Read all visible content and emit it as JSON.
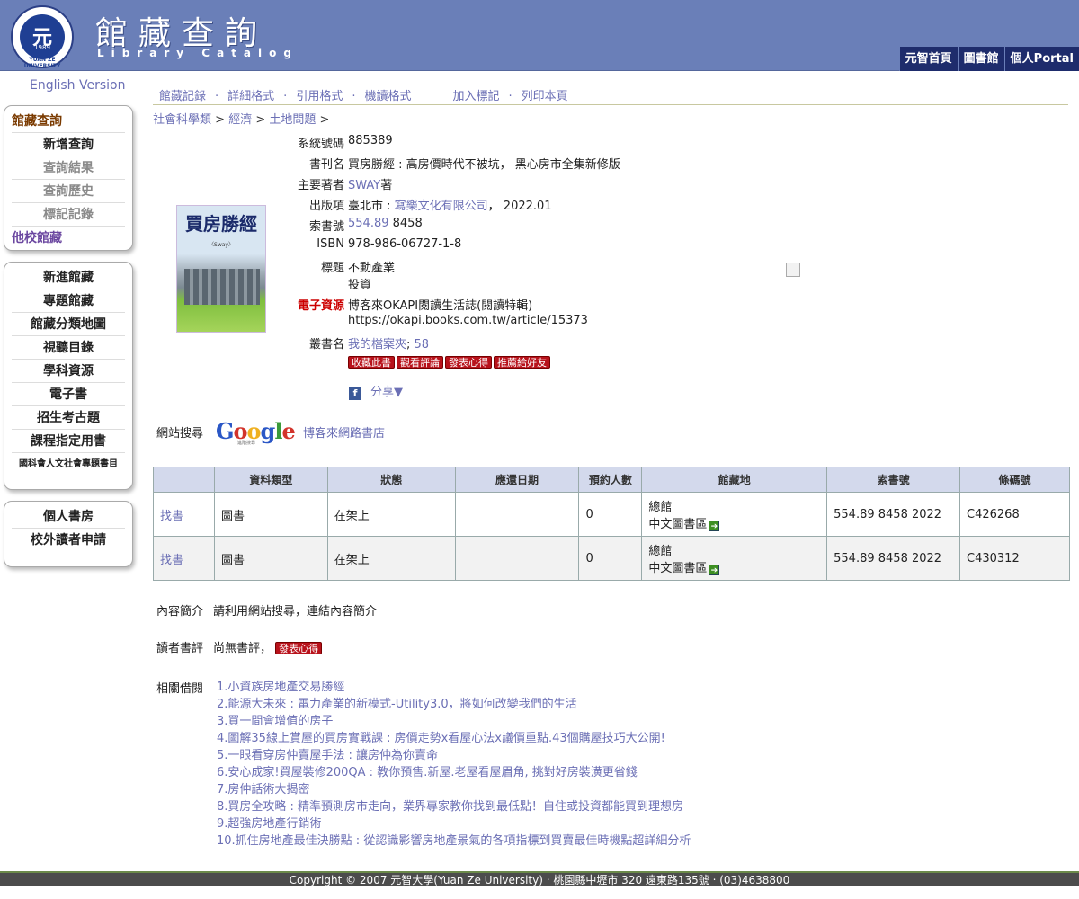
{
  "header": {
    "logo_year": "1989",
    "logo_ring_text": "YUAN ZE UNIVERSITY",
    "title": "館藏查詢",
    "subtitle": "Library Catalog",
    "nav": [
      "元智首頁",
      "圖書館",
      "個人Portal"
    ]
  },
  "sidebar": {
    "english_version": "English Version",
    "box1": {
      "head": "館藏查詢",
      "items": [
        "新增查詢",
        "查詢結果",
        "查詢歷史",
        "標記記錄"
      ],
      "footer": "他校館藏"
    },
    "box2": {
      "items": [
        "新進館藏",
        "專題館藏",
        "館藏分類地圖",
        "視聽目錄",
        "學科資源",
        "電子書",
        "招生考古題",
        "課程指定用書",
        "國科會人文社會專題書目"
      ]
    },
    "box3": {
      "items": [
        "個人書房",
        "校外讀者申請"
      ]
    }
  },
  "actions": [
    "館藏記錄",
    "詳細格式",
    "引用格式",
    "機讀格式",
    "加入標記",
    "列印本頁"
  ],
  "breadcrumb": [
    "社會科學類",
    "經濟",
    "土地問題"
  ],
  "cover": {
    "title": "買房勝經",
    "author_tag": "〈Sway〉"
  },
  "record": {
    "system_no_label": "系統號碼",
    "system_no": "885389",
    "title_label": "書刊名",
    "title": "買房勝經 : 高房價時代不被坑， 黑心房市全集新修版",
    "author_label": "主要著者",
    "author": "SWAY",
    "author_suffix": "著",
    "publisher_label": "出版項",
    "pub_place": "臺北市 : ",
    "publisher": "寫樂文化有限公司",
    "pub_date": "，  2022.01",
    "callno_label": "索書號",
    "callno_link": "554.89",
    "callno_rest": "8458",
    "isbn_label": "ISBN",
    "isbn": "978-986-06727-1-8",
    "subject_label": "標題",
    "subjects": [
      "不動產業",
      "投資"
    ],
    "eresource_label": "電子資源",
    "eresource_text": "博客來OKAPI閱讀生活誌(閱讀特輯)",
    "eresource_url": "https://okapi.books.com.tw/article/15373",
    "series_label": "叢書名",
    "series": "我的檔案夾",
    "series_sep": "; ",
    "series_no": "58",
    "buttons": [
      "收藏此書",
      "觀看評論",
      "發表心得",
      "推薦給好友"
    ],
    "share": "分享▼"
  },
  "web_search": {
    "label": "網站搜尋",
    "google_letters": [
      "G",
      "o",
      "o",
      "g",
      "l",
      "e"
    ],
    "google_sub": "進階搜尋",
    "bookstore": "博客來網路書店"
  },
  "holdings": {
    "headers": [
      "",
      "資料類型",
      "狀態",
      "應還日期",
      "預約人數",
      "館藏地",
      "索書號",
      "條碼號"
    ],
    "rows": [
      {
        "find": "找書",
        "type": "圖書",
        "status": "在架上",
        "due": "",
        "holds": "0",
        "loc1": "總館",
        "loc2": "中文圖書區",
        "callno": "554.89 8458 2022",
        "barcode": "C426268"
      },
      {
        "find": "找書",
        "type": "圖書",
        "status": "在架上",
        "due": "",
        "holds": "0",
        "loc1": "總館",
        "loc2": "中文圖書區",
        "callno": "554.89 8458 2022",
        "barcode": "C430312"
      }
    ]
  },
  "summary": {
    "label": "內容簡介",
    "text": "請利用網站搜尋，連結內容簡介"
  },
  "reviews": {
    "label": "讀者書評",
    "text": "尚無書評，",
    "button": "發表心得"
  },
  "related": {
    "label": "相關借閱",
    "items": [
      "1.小資族房地產交易勝經",
      "2.能源大未來 : 電力產業的新模式-Utility3.0，將如何改變我們的生活",
      "3.買一間會增值的房子",
      "4.圖解35線上賞屋的買房實戰課 : 房價走勢x看屋心法x議價重點.43個購屋技巧大公開!",
      "5.一眼看穿房仲賣屋手法 : 讓房仲為你賣命",
      "6.安心成家!買屋裝修200QA : 教你預售.新屋.老屋看屋眉角, 挑對好房裝潢更省錢",
      "7.房仲話術大揭密",
      "8.買房全攻略 : 精準預測房市走向，業界專家教你找到最低點！自住或投資都能買到理想房",
      "9.超強房地產行銷術",
      "10.抓住房地產最佳決勝點 : 從認識影響房地產景氣的各項指標到買賣最佳時機點超詳細分析"
    ]
  },
  "footer": "Copyright © 2007 元智大學(Yuan Ze University) ‧ 桃園縣中壢市 320 遠東路135號 ‧ (03)4638800"
}
